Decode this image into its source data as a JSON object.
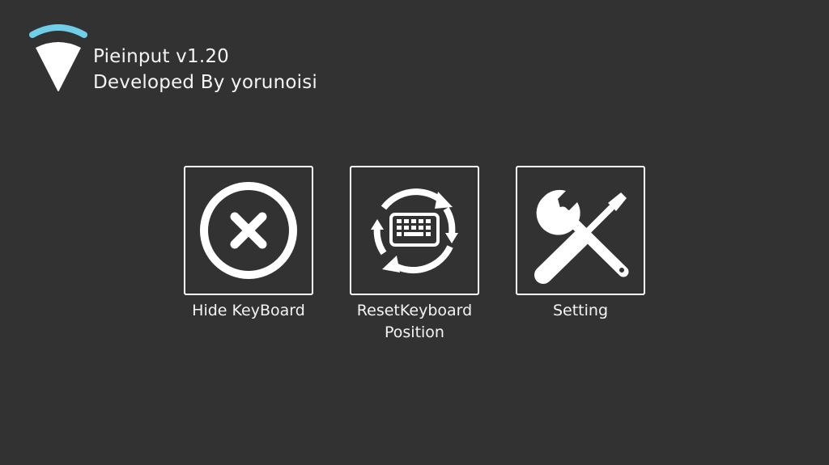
{
  "header": {
    "app_title": "Pieinput v1.20",
    "developer": "Developed By yorunoisi",
    "logo_icon": "pie-slice-logo-icon"
  },
  "colors": {
    "background": "#323232",
    "accent": "#6fcfe8",
    "foreground": "#ffffff"
  },
  "menu": {
    "items": [
      {
        "label": "Hide KeyBoard",
        "icon": "close-circle-icon"
      },
      {
        "label": "ResetKeyboard\nPosition",
        "icon": "keyboard-refresh-icon"
      },
      {
        "label": "Setting",
        "icon": "tools-icon"
      }
    ]
  }
}
